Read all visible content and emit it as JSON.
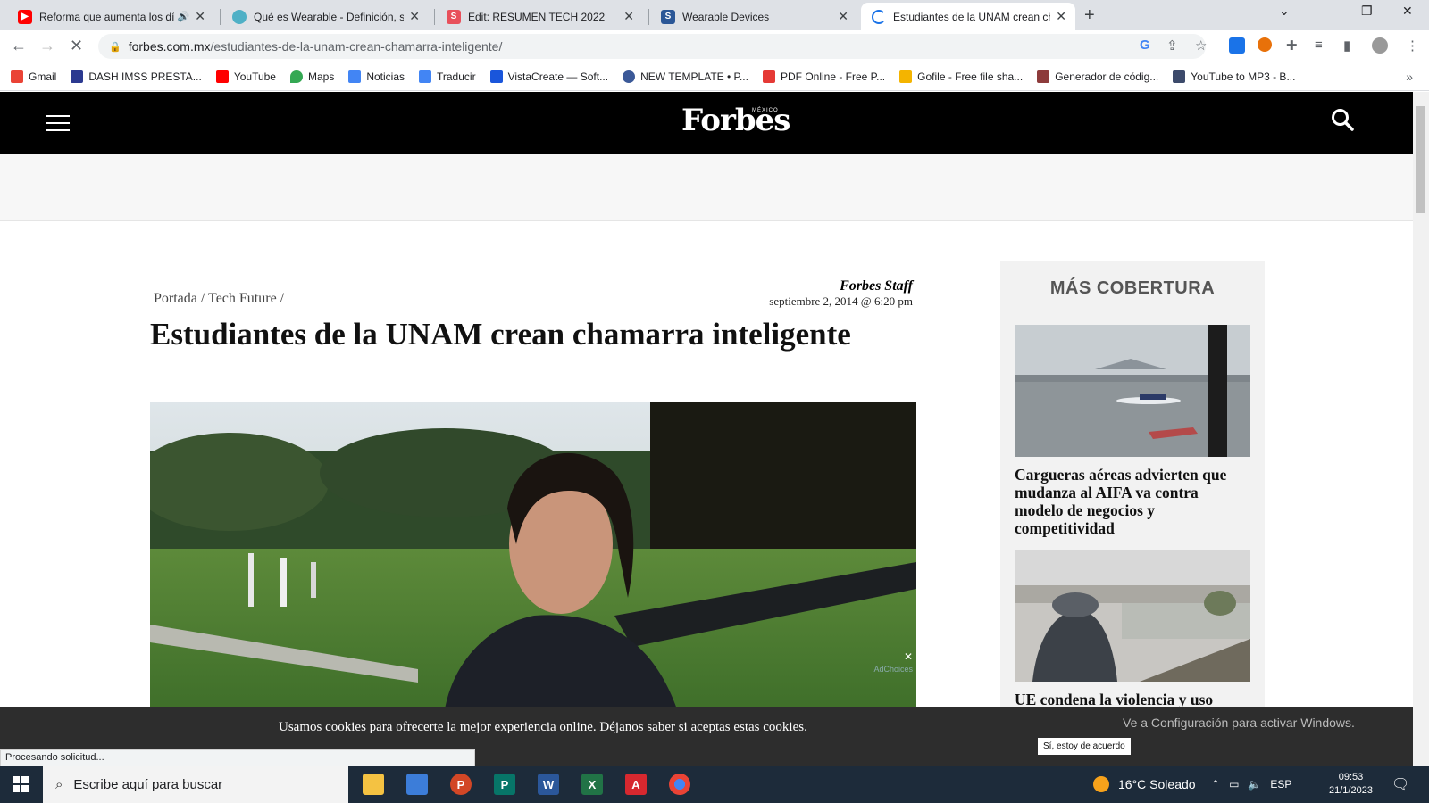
{
  "browser": {
    "tabs": [
      {
        "title": "Reforma que aumenta los dí",
        "favicon": "youtube-icon",
        "color": "#ff0000",
        "audio": true
      },
      {
        "title": "Qué es Wearable - Definición, sig",
        "favicon": "globe-icon",
        "color": "#4fb0c6"
      },
      {
        "title": "Edit: RESUMEN TECH 2022",
        "favicon": "s-icon",
        "color": "#e8505b"
      },
      {
        "title": "Wearable Devices",
        "favicon": "s-icon",
        "color": "#2b5797"
      },
      {
        "title": "Estudiantes de la UNAM crean ch",
        "favicon": "loading-icon",
        "color": "#1a73e8"
      }
    ],
    "url_domain": "forbes.com.mx",
    "url_path": "/estudiantes-de-la-unam-crean-chamarra-inteligente/",
    "status_text": "Procesando solicitud..."
  },
  "bookmarks": [
    {
      "label": "Gmail",
      "color": "#ea4335"
    },
    {
      "label": "DASH IMSS PRESTA...",
      "color": "#2b3990"
    },
    {
      "label": "YouTube",
      "color": "#ff0000"
    },
    {
      "label": "Maps",
      "color": "#34a853"
    },
    {
      "label": "Noticias",
      "color": "#4285f4"
    },
    {
      "label": "Traducir",
      "color": "#4285f4"
    },
    {
      "label": "VistaCreate — Soft...",
      "color": "#1a56db"
    },
    {
      "label": "NEW TEMPLATE • P...",
      "color": "#3b5998"
    },
    {
      "label": "PDF Online - Free P...",
      "color": "#e53935"
    },
    {
      "label": "Gofile - Free file sha...",
      "color": "#f4b400"
    },
    {
      "label": "Generador de códig...",
      "color": "#8d3b3b"
    },
    {
      "label": "YouTube to MP3 - B...",
      "color": "#3c4a6b"
    }
  ],
  "site": {
    "logo": "Forbes",
    "logo_sub": "MÉXICO"
  },
  "article": {
    "breadcrumb": "Portada / Tech Future /",
    "author": "Forbes Staff",
    "date": "septiembre 2, 2014 @ 6:20 pm",
    "headline": "Estudiantes de la UNAM crean chamarra inteligente",
    "ad_choices": "AdChoices"
  },
  "sidebar": {
    "title": "MÁS COBERTURA",
    "items": [
      {
        "caption": "Cargueras aéreas advierten que mudanza al AIFA va contra modelo de negocios y competitividad"
      },
      {
        "caption": "UE condena la violencia y uso"
      }
    ]
  },
  "cookie_bar": {
    "text": "Usamos cookies para ofrecerte la mejor experiencia online. Déjanos saber si aceptas estas cookies.",
    "button": "Sí, estoy de acuerdo",
    "watermark": "Ve a Configuración para activar Windows."
  },
  "taskbar": {
    "search_placeholder": "Escribe aquí para buscar",
    "weather": "16°C  Soleado",
    "lang": "ESP",
    "time": "09:53",
    "date": "21/1/2023"
  }
}
